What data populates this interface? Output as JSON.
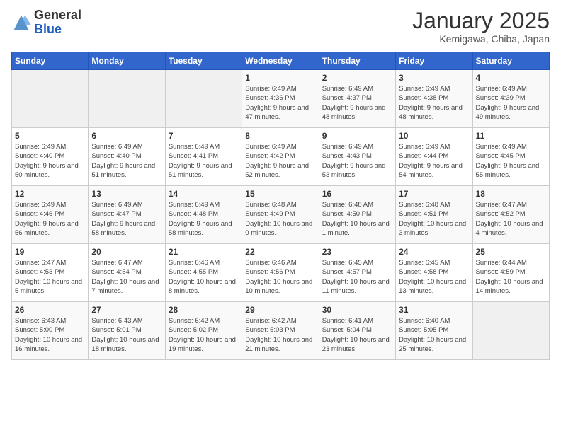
{
  "header": {
    "logo_general": "General",
    "logo_blue": "Blue",
    "month_title": "January 2025",
    "location": "Kemigawa, Chiba, Japan"
  },
  "days_of_week": [
    "Sunday",
    "Monday",
    "Tuesday",
    "Wednesday",
    "Thursday",
    "Friday",
    "Saturday"
  ],
  "weeks": [
    [
      {
        "day": "",
        "info": ""
      },
      {
        "day": "",
        "info": ""
      },
      {
        "day": "",
        "info": ""
      },
      {
        "day": "1",
        "info": "Sunrise: 6:49 AM\nSunset: 4:36 PM\nDaylight: 9 hours\nand 47 minutes."
      },
      {
        "day": "2",
        "info": "Sunrise: 6:49 AM\nSunset: 4:37 PM\nDaylight: 9 hours\nand 48 minutes."
      },
      {
        "day": "3",
        "info": "Sunrise: 6:49 AM\nSunset: 4:38 PM\nDaylight: 9 hours\nand 48 minutes."
      },
      {
        "day": "4",
        "info": "Sunrise: 6:49 AM\nSunset: 4:39 PM\nDaylight: 9 hours\nand 49 minutes."
      }
    ],
    [
      {
        "day": "5",
        "info": "Sunrise: 6:49 AM\nSunset: 4:40 PM\nDaylight: 9 hours\nand 50 minutes."
      },
      {
        "day": "6",
        "info": "Sunrise: 6:49 AM\nSunset: 4:40 PM\nDaylight: 9 hours\nand 51 minutes."
      },
      {
        "day": "7",
        "info": "Sunrise: 6:49 AM\nSunset: 4:41 PM\nDaylight: 9 hours\nand 51 minutes."
      },
      {
        "day": "8",
        "info": "Sunrise: 6:49 AM\nSunset: 4:42 PM\nDaylight: 9 hours\nand 52 minutes."
      },
      {
        "day": "9",
        "info": "Sunrise: 6:49 AM\nSunset: 4:43 PM\nDaylight: 9 hours\nand 53 minutes."
      },
      {
        "day": "10",
        "info": "Sunrise: 6:49 AM\nSunset: 4:44 PM\nDaylight: 9 hours\nand 54 minutes."
      },
      {
        "day": "11",
        "info": "Sunrise: 6:49 AM\nSunset: 4:45 PM\nDaylight: 9 hours\nand 55 minutes."
      }
    ],
    [
      {
        "day": "12",
        "info": "Sunrise: 6:49 AM\nSunset: 4:46 PM\nDaylight: 9 hours\nand 56 minutes."
      },
      {
        "day": "13",
        "info": "Sunrise: 6:49 AM\nSunset: 4:47 PM\nDaylight: 9 hours\nand 58 minutes."
      },
      {
        "day": "14",
        "info": "Sunrise: 6:49 AM\nSunset: 4:48 PM\nDaylight: 9 hours\nand 58 minutes."
      },
      {
        "day": "15",
        "info": "Sunrise: 6:48 AM\nSunset: 4:49 PM\nDaylight: 10 hours\nand 0 minutes."
      },
      {
        "day": "16",
        "info": "Sunrise: 6:48 AM\nSunset: 4:50 PM\nDaylight: 10 hours\nand 1 minute."
      },
      {
        "day": "17",
        "info": "Sunrise: 6:48 AM\nSunset: 4:51 PM\nDaylight: 10 hours\nand 3 minutes."
      },
      {
        "day": "18",
        "info": "Sunrise: 6:47 AM\nSunset: 4:52 PM\nDaylight: 10 hours\nand 4 minutes."
      }
    ],
    [
      {
        "day": "19",
        "info": "Sunrise: 6:47 AM\nSunset: 4:53 PM\nDaylight: 10 hours\nand 5 minutes."
      },
      {
        "day": "20",
        "info": "Sunrise: 6:47 AM\nSunset: 4:54 PM\nDaylight: 10 hours\nand 7 minutes."
      },
      {
        "day": "21",
        "info": "Sunrise: 6:46 AM\nSunset: 4:55 PM\nDaylight: 10 hours\nand 8 minutes."
      },
      {
        "day": "22",
        "info": "Sunrise: 6:46 AM\nSunset: 4:56 PM\nDaylight: 10 hours\nand 10 minutes."
      },
      {
        "day": "23",
        "info": "Sunrise: 6:45 AM\nSunset: 4:57 PM\nDaylight: 10 hours\nand 11 minutes."
      },
      {
        "day": "24",
        "info": "Sunrise: 6:45 AM\nSunset: 4:58 PM\nDaylight: 10 hours\nand 13 minutes."
      },
      {
        "day": "25",
        "info": "Sunrise: 6:44 AM\nSunset: 4:59 PM\nDaylight: 10 hours\nand 14 minutes."
      }
    ],
    [
      {
        "day": "26",
        "info": "Sunrise: 6:43 AM\nSunset: 5:00 PM\nDaylight: 10 hours\nand 16 minutes."
      },
      {
        "day": "27",
        "info": "Sunrise: 6:43 AM\nSunset: 5:01 PM\nDaylight: 10 hours\nand 18 minutes."
      },
      {
        "day": "28",
        "info": "Sunrise: 6:42 AM\nSunset: 5:02 PM\nDaylight: 10 hours\nand 19 minutes."
      },
      {
        "day": "29",
        "info": "Sunrise: 6:42 AM\nSunset: 5:03 PM\nDaylight: 10 hours\nand 21 minutes."
      },
      {
        "day": "30",
        "info": "Sunrise: 6:41 AM\nSunset: 5:04 PM\nDaylight: 10 hours\nand 23 minutes."
      },
      {
        "day": "31",
        "info": "Sunrise: 6:40 AM\nSunset: 5:05 PM\nDaylight: 10 hours\nand 25 minutes."
      },
      {
        "day": "",
        "info": ""
      }
    ]
  ]
}
